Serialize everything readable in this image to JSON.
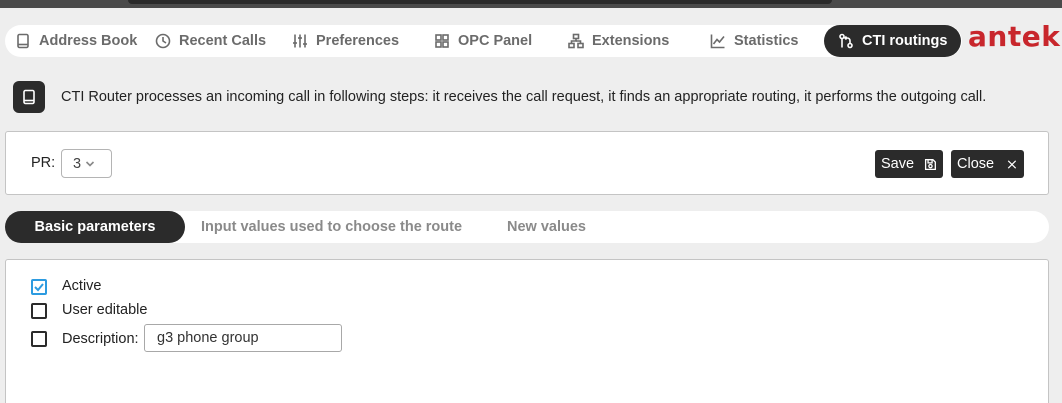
{
  "nav": {
    "items": [
      {
        "label": "Address Book",
        "icon": "book-icon"
      },
      {
        "label": "Recent Calls",
        "icon": "clock-icon"
      },
      {
        "label": "Preferences",
        "icon": "sliders-icon"
      },
      {
        "label": "OPC Panel",
        "icon": "grid-icon"
      },
      {
        "label": "Extensions",
        "icon": "network-icon"
      },
      {
        "label": "Statistics",
        "icon": "chart-icon"
      },
      {
        "label": "CTI routings",
        "icon": "routing-icon",
        "active": true
      }
    ]
  },
  "logo": "antek",
  "info": {
    "icon": "book-icon",
    "text": "CTI Router processes an incoming call in following steps: it receives the call request, it finds an appropriate routing, it performs the outgoing call."
  },
  "form": {
    "pr_label": "PR:",
    "pr_value": "3",
    "save_label": "Save",
    "close_label": "Close"
  },
  "tabs": [
    {
      "label": "Basic parameters",
      "active": true
    },
    {
      "label": "Input values used to choose the route"
    },
    {
      "label": "New values"
    }
  ],
  "basic": {
    "active_label": "Active",
    "active_checked": true,
    "user_editable_label": "User editable",
    "user_editable_checked": false,
    "description_label": "Description:",
    "description_checked": false,
    "description_value": "g3 phone group"
  },
  "colors": {
    "brand": "#c8262c",
    "dark": "#2b2b2b",
    "check_accent": "#2c9be0"
  }
}
